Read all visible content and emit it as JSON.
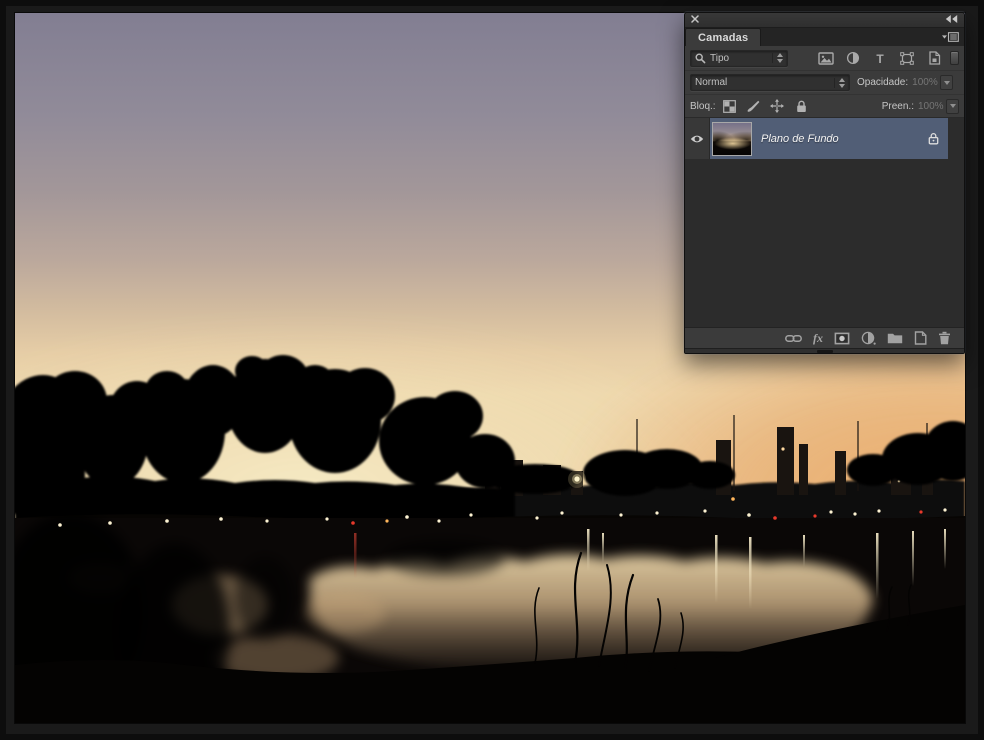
{
  "panel": {
    "title_tab": "Camadas",
    "titlebar_icons": [
      "close-icon",
      "collapse-panels-icon"
    ],
    "filter_row": {
      "search_dropdown_value": "Tipo",
      "filter_icons": [
        "pixel-layers-filter-icon",
        "adjustment-layers-filter-icon",
        "type-layers-filter-icon",
        "shape-layers-filter-icon",
        "smart-objects-filter-icon"
      ],
      "toggle": "layer-filter-toggle"
    },
    "blend_row": {
      "blend_mode": "Normal",
      "opacity_label": "Opacidade:",
      "opacity_value": "100%"
    },
    "lock_row": {
      "label": "Bloq.:",
      "lock_icons": [
        "lock-transparency-icon",
        "lock-pixels-icon",
        "lock-position-icon",
        "lock-all-icon"
      ],
      "fill_label": "Preen.:",
      "fill_value": "100%"
    },
    "layers": [
      {
        "name": "Plano de Fundo",
        "visible": true,
        "locked": true,
        "selected": true
      }
    ],
    "bottom_bar": {
      "fx_label": "fx",
      "icons": [
        "link-layers-icon",
        "layer-effects-icon",
        "add-layer-mask-icon",
        "new-adjustment-layer-icon",
        "new-group-icon",
        "new-layer-icon",
        "delete-layer-icon"
      ]
    }
  },
  "colors": {
    "panel_bg": "#3b3b3b",
    "panel_list_bg": "#2c2c2c",
    "selected_layer_row": "#515e76",
    "app_bg": "#1a1a1a",
    "sky_top": "#827e92",
    "sky_mauve": "#a39799",
    "sky_cream": "#e6cda6",
    "sunset_orange": "#e8a863",
    "water_reflection": "#e3c79c",
    "silhouette": "#060402"
  }
}
